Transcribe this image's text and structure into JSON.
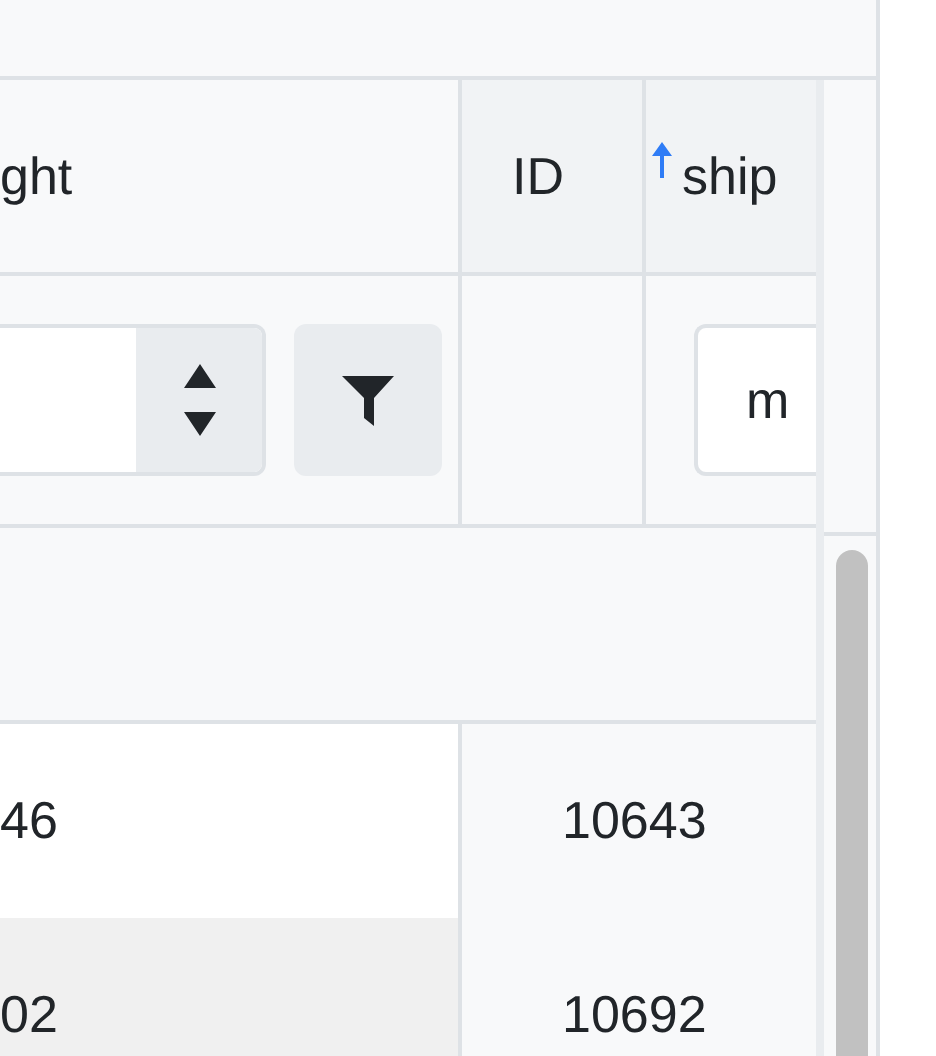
{
  "columns": [
    {
      "label": "ght",
      "sorted": false
    },
    {
      "label": "ID",
      "sorted": false
    },
    {
      "label": "ship",
      "sorted": true
    }
  ],
  "filters": [
    {
      "kind": "number"
    },
    {
      "kind": "none"
    },
    {
      "kind": "text",
      "value": "m"
    }
  ],
  "rows": [
    {
      "cells": [
        "46",
        "10643"
      ],
      "shaded": false
    },
    {
      "cells": [
        "02",
        "10692"
      ],
      "shaded": true
    }
  ]
}
